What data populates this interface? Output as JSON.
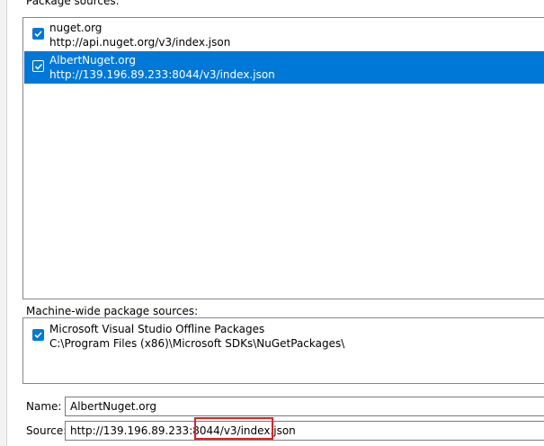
{
  "package_sources": {
    "label": "Package sources:",
    "items": [
      {
        "name": "nuget.org",
        "url": "http://api.nuget.org/v3/index.json",
        "checked": true,
        "selected": false
      },
      {
        "name": "AlbertNuget.org",
        "url": "http://139.196.89.233:8044/v3/index.json",
        "checked": true,
        "selected": true
      }
    ]
  },
  "machine_wide_sources": {
    "label": "Machine-wide package sources:",
    "items": [
      {
        "name": "Microsoft Visual Studio Offline Packages",
        "url": "C:\\Program Files (x86)\\Microsoft SDKs\\NuGetPackages\\",
        "checked": true
      }
    ]
  },
  "fields": {
    "name_label": "Name:",
    "name_value": "AlbertNuget.org",
    "source_label": "Source:",
    "source_value": "http://139.196.89.233:8044/v3/index.json"
  },
  "colors": {
    "selection": "#0078d7",
    "annotation": "#d9252a"
  }
}
